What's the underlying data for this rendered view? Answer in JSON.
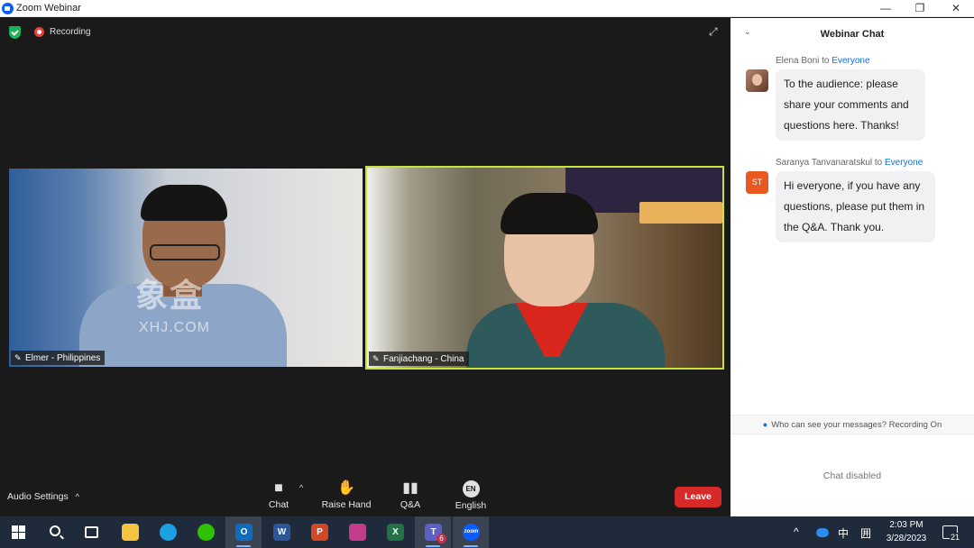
{
  "window": {
    "title": "Zoom Webinar",
    "minimize_label": "—",
    "restore_label": "❐",
    "close_label": "✕"
  },
  "meeting": {
    "recording_label": "Recording",
    "expand_label": "⤢",
    "watermark": "象盒",
    "watermark_sub": "XHJ.COM"
  },
  "participants": [
    {
      "name": "Elmer - Philippines"
    },
    {
      "name": "Fanjiachang - China"
    }
  ],
  "controls": {
    "audio_settings": "Audio Settings",
    "audio_caret": "^",
    "chat_caret": "^",
    "chat": "Chat",
    "raise_hand": "Raise Hand",
    "qa": "Q&A",
    "english": "English",
    "english_badge": "EN",
    "leave": "Leave"
  },
  "chat": {
    "title": "Webinar Chat",
    "collapse_label": "⌄",
    "messages": [
      {
        "sender": "Elena Boni",
        "to_word": "to",
        "target": "Everyone",
        "text": "To the audience: please share your comments and questions here. Thanks!"
      },
      {
        "sender": "Saranya Tanvanaratskul",
        "to_word": "to",
        "target": "Everyone",
        "initials": "ST",
        "text": "Hi everyone, if you have any questions, please put them in the Q&A. Thank you."
      }
    ],
    "privacy_text": "Who can see your messages? Recording On",
    "disabled_text": "Chat disabled"
  },
  "taskbar": {
    "apps": [
      {
        "name": "file-explorer",
        "glyph": "",
        "color": "#f5c542"
      },
      {
        "name": "edge",
        "glyph": "",
        "color": "#1ba0e2"
      },
      {
        "name": "wechat",
        "glyph": "",
        "color": "#2dc100"
      },
      {
        "name": "outlook",
        "glyph": "O",
        "color": "#0f6cbd"
      },
      {
        "name": "word",
        "glyph": "W",
        "color": "#2b579a"
      },
      {
        "name": "powerpoint",
        "glyph": "P",
        "color": "#d24726"
      },
      {
        "name": "app-swirl",
        "glyph": "",
        "color": "#c43c8a"
      },
      {
        "name": "excel",
        "glyph": "X",
        "color": "#217346"
      },
      {
        "name": "teams",
        "glyph": "T",
        "color": "#5b5fc7"
      },
      {
        "name": "zoom",
        "glyph": "zoom",
        "color": "#0b5cff"
      }
    ],
    "teams_badge": "6",
    "ime_label": "中",
    "ime_mode_label": "囲",
    "chevron_label": "^",
    "time": "2:03 PM",
    "date": "3/28/2023",
    "notification_count": "21"
  }
}
